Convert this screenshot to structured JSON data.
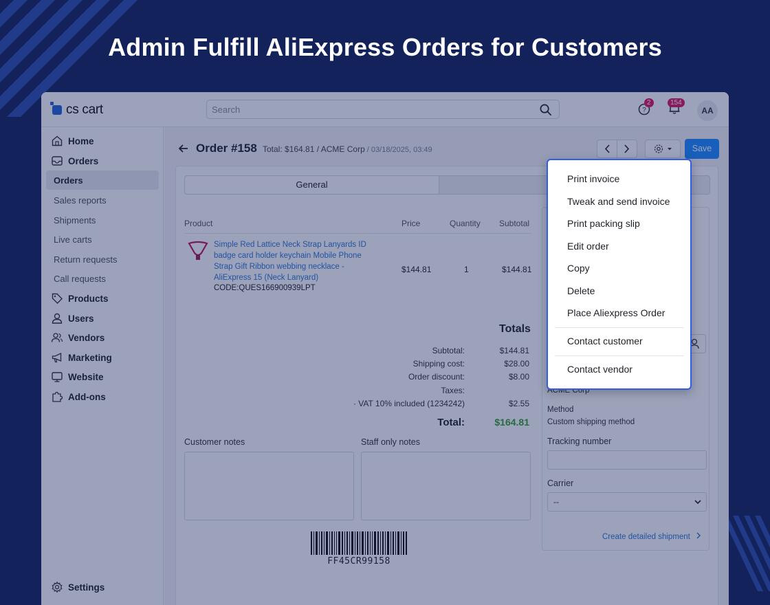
{
  "banner": {
    "title": "Admin Fulfill AliExpress Orders for Customers"
  },
  "colors": {
    "background": "#13225a",
    "accent": "#1a8cff",
    "link": "#2b78d0",
    "total": "#35a035",
    "badge": "#e0185a",
    "dropdown_border": "#2f5de6"
  },
  "app": {
    "logo": "cs cart"
  },
  "search": {
    "placeholder": "Search"
  },
  "topbar": {
    "help_badge": "2",
    "notifications_badge": "154",
    "avatar": "AA"
  },
  "sidebar": {
    "items": [
      {
        "label": "Home",
        "icon": "home-icon"
      },
      {
        "label": "Orders",
        "icon": "inbox-icon"
      }
    ],
    "orders_sub": [
      "Orders",
      "Sales reports",
      "Shipments",
      "Live carts",
      "Return requests",
      "Call requests"
    ],
    "items2": [
      {
        "label": "Products",
        "icon": "tag-icon"
      },
      {
        "label": "Users",
        "icon": "user-icon"
      },
      {
        "label": "Vendors",
        "icon": "users-icon"
      },
      {
        "label": "Marketing",
        "icon": "megaphone-icon"
      },
      {
        "label": "Website",
        "icon": "monitor-icon"
      },
      {
        "label": "Add-ons",
        "icon": "puzzle-icon"
      }
    ],
    "settings": "Settings"
  },
  "order": {
    "title": "Order #158",
    "meta": "Total: $164.81 / ACME Corp",
    "date": " / 03/18/2025, 03:49",
    "save": "Save"
  },
  "tabs": [
    "General"
  ],
  "table": {
    "headers": [
      "Product",
      "Price",
      "Quantity",
      "Subtotal"
    ],
    "rows": [
      {
        "name": "Simple Red Lattice Neck Strap Lanyards ID badge card holder keychain Mobile Phone Strap Gift Ribbon webbing necklace - AliExpress 15 (Neck Lanyard)",
        "code": "CODE:QUES166900939LPT",
        "price": "$144.81",
        "quantity": "1",
        "subtotal": "$144.81"
      }
    ]
  },
  "totals": {
    "heading": "Totals",
    "rows": [
      {
        "label": "Subtotal:",
        "value": "$144.81"
      },
      {
        "label": "Shipping cost:",
        "value": "$28.00"
      },
      {
        "label": "Order discount:",
        "value": "$8.00"
      },
      {
        "label": "Taxes:",
        "value": ""
      },
      {
        "label": "· VAT 10% included (1234242)",
        "value": "$2.55"
      }
    ],
    "total_label": "Total:",
    "total_value": "$164.81"
  },
  "notes": {
    "customer": "Customer notes",
    "staff": "Staff only notes"
  },
  "barcode": "FF45CR99158",
  "shipping": {
    "company": "ACME Corp",
    "method_label": "Method",
    "method_value": "Custom shipping method",
    "tracking_label": "Tracking number",
    "carrier_label": "Carrier",
    "carrier_value": "--",
    "create_link": "Create detailed shipment"
  },
  "dropdown": {
    "group1": [
      "Print invoice",
      "Tweak and send invoice",
      "Print packing slip",
      "Edit order",
      "Copy",
      "Delete",
      "Place Aliexpress Order"
    ],
    "group2": [
      "Contact customer"
    ],
    "group3": [
      "Contact vendor"
    ]
  }
}
